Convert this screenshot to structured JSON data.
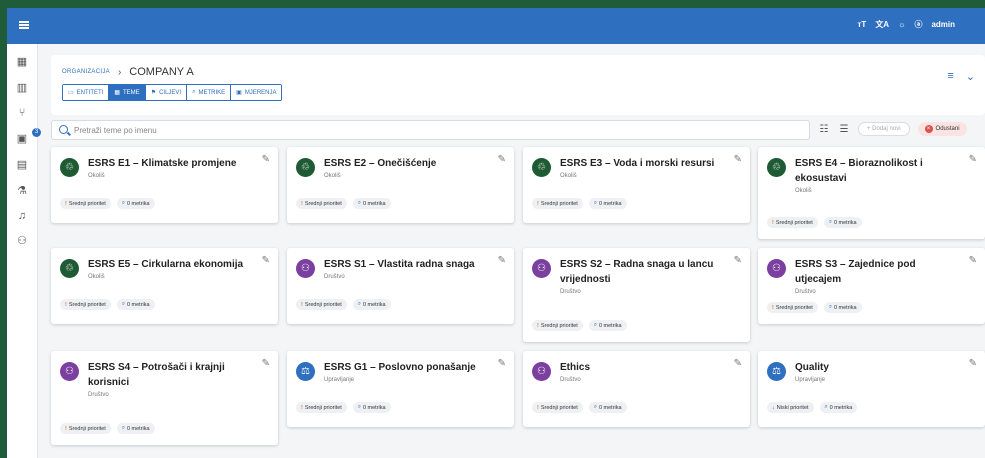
{
  "topbar": {
    "icons": [
      "text-size-icon",
      "translate-icon",
      "brightness-icon",
      "account-icon"
    ],
    "user": "admin"
  },
  "sidebar": {
    "items": [
      "dashboard-icon",
      "map-icon",
      "hierarchy-icon",
      "chat-icon",
      "report-icon",
      "lab-flask-icon",
      "bell-icon",
      "users-icon"
    ],
    "badge": "3"
  },
  "breadcrumb": {
    "root": "ORGANIZACIJA",
    "separator": "›",
    "current": "COMPANY A"
  },
  "tabs": [
    {
      "label": "ENTITETI",
      "icon": "folder-icon"
    },
    {
      "label": "TEME",
      "icon": "table-icon",
      "active": true
    },
    {
      "label": "CILJEVI",
      "icon": "flag-icon"
    },
    {
      "label": "METRIKE",
      "icon": "search-metric-icon"
    },
    {
      "label": "MJERENJA",
      "icon": "measure-icon"
    }
  ],
  "search": {
    "placeholder": "Pretraži teme po imenu"
  },
  "toolbar": {
    "add_label": "+ Dodaj novi",
    "cancel_label": "Odustani"
  },
  "colors": {
    "accent": "#2f6fc0",
    "env": "#1e5b34",
    "social": "#7b3fa0",
    "gov": "#2f6fc0",
    "priority": "#e07b28"
  },
  "cards": [
    {
      "title": "ESRS E1 – Klimatske promjene",
      "category": "Okoliš",
      "priority": "Srednji prioritet",
      "metrics": "0 metrika",
      "type": "env"
    },
    {
      "title": "ESRS E2 – Onečišćenje",
      "category": "Okoliš",
      "priority": "Srednji prioritet",
      "metrics": "0 metrika",
      "type": "env"
    },
    {
      "title": "ESRS E3 – Voda i morski resursi",
      "category": "Okoliš",
      "priority": "Srednji prioritet",
      "metrics": "0 metrika",
      "type": "env"
    },
    {
      "title": "ESRS E4 – Bioraznolikost i ekosustavi",
      "category": "Okoliš",
      "priority": "Srednji prioritet",
      "metrics": "0 metrika",
      "type": "env"
    },
    {
      "title": "ESRS E5 – Cirkularna ekonomija",
      "category": "Okoliš",
      "priority": "Srednji prioritet",
      "metrics": "0 metrika",
      "type": "env"
    },
    {
      "title": "ESRS S1 – Vlastita radna snaga",
      "category": "Društvo",
      "priority": "Srednji prioritet",
      "metrics": "0 metrika",
      "type": "social"
    },
    {
      "title": "ESRS S2 – Radna snaga u lancu vrijednosti",
      "category": "Društvo",
      "priority": "Srednji prioritet",
      "metrics": "0 metrika",
      "type": "social"
    },
    {
      "title": "ESRS S3 – Zajednice pod utjecajem",
      "category": "Društvo",
      "priority": "Srednji prioritet",
      "metrics": "0 metrika",
      "type": "social"
    },
    {
      "title": "ESRS S4 – Potrošači i krajnji korisnici",
      "category": "Društvo",
      "priority": "Srednji prioritet",
      "metrics": "0 metrika",
      "type": "social"
    },
    {
      "title": "ESRS G1 – Poslovno ponašanje",
      "category": "Upravljanje",
      "priority": "Srednji prioritet",
      "metrics": "0 metrika",
      "type": "gov"
    },
    {
      "title": "Ethics",
      "category": "Društvo",
      "priority": "Srednji prioritet",
      "metrics": "0 metrika",
      "type": "social"
    },
    {
      "title": "Quality",
      "category": "Upravljanje",
      "priority": "Niski prioritet",
      "metrics": "0 metrika",
      "type": "gov",
      "low": true
    }
  ]
}
